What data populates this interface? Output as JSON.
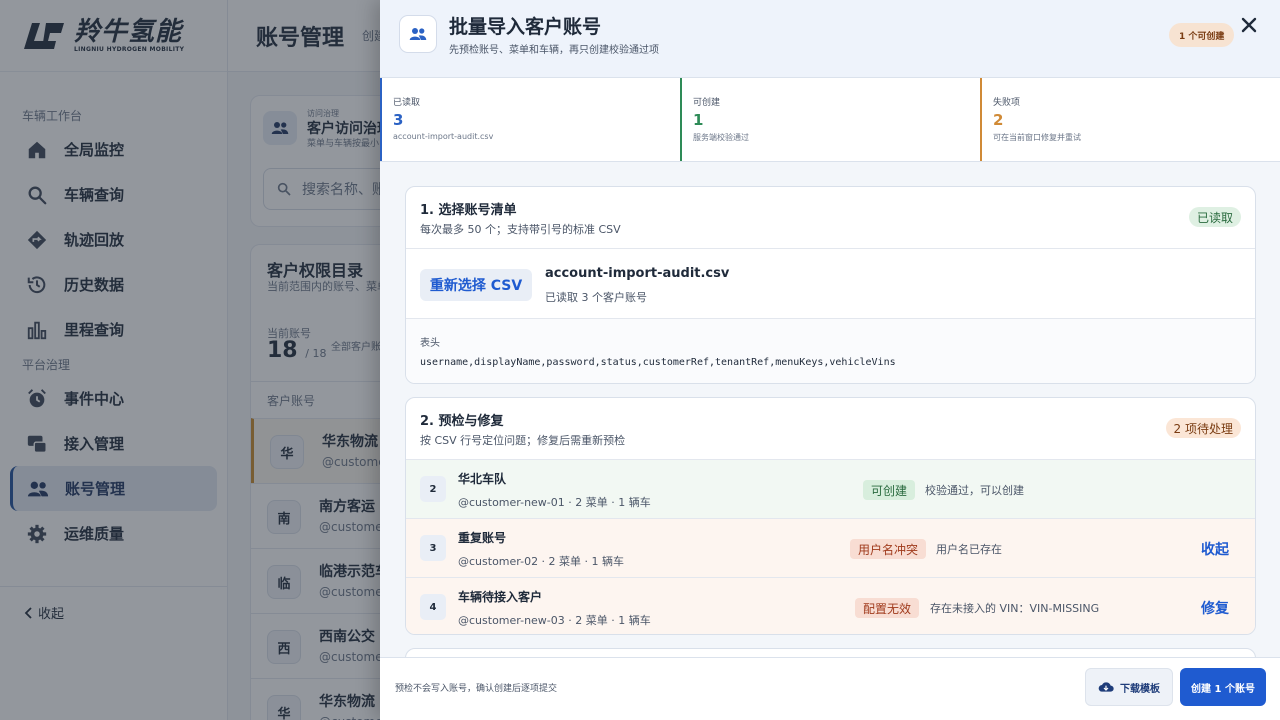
{
  "brand": {
    "name_cn": "羚牛氢能",
    "name_en": "LINGNIU HYDROGEN MOBILITY"
  },
  "sidebar": {
    "section1": "车辆工作台",
    "section2": "平台治理",
    "items": [
      {
        "label": "全局监控",
        "icon": "home-icon"
      },
      {
        "label": "车辆查询",
        "icon": "search-icon"
      },
      {
        "label": "轨迹回放",
        "icon": "route-icon"
      },
      {
        "label": "历史数据",
        "icon": "history-icon"
      },
      {
        "label": "里程查询",
        "icon": "bar-chart-icon"
      },
      {
        "label": "事件中心",
        "icon": "alarm-icon"
      },
      {
        "label": "接入管理",
        "icon": "device-icon"
      },
      {
        "label": "账号管理",
        "icon": "users-icon"
      },
      {
        "label": "运维质量",
        "icon": "gear-icon"
      }
    ],
    "collapse_label": "收起"
  },
  "main": {
    "title": "账号管理",
    "subtitle": "创建",
    "access_tag": "访问治理",
    "access_title": "客户访问治理",
    "access_sub": "菜单与车辆按最小",
    "search_placeholder": "搜索名称、账号",
    "dir_title": "客户权限目录",
    "dir_sub": "当前范围内的账号、菜单",
    "current_label": "当前账号",
    "current_count": "18",
    "current_total": "/ 18",
    "current_note": "全部客户账",
    "list_header": "客户账号",
    "customers": [
      {
        "avatar": "华",
        "name": "华东物流",
        "id": "@customer"
      },
      {
        "avatar": "南",
        "name": "南方客运",
        "id": "@customer"
      },
      {
        "avatar": "临",
        "name": "临港示范车",
        "id": "@customer"
      },
      {
        "avatar": "西",
        "name": "西南公交",
        "id": "@customer"
      },
      {
        "avatar": "华",
        "name": "华东物流",
        "id": "@customer"
      }
    ]
  },
  "drawer": {
    "title": "批量导入客户账号",
    "subtitle": "先预检账号、菜单和车辆，再只创建校验通过项",
    "badge": "1 个可创建",
    "stats": [
      {
        "label": "已读取",
        "value": "3",
        "note": "account-import-audit.csv",
        "color": "#2b62c4"
      },
      {
        "label": "可创建",
        "value": "1",
        "note": "服务端校验通过",
        "color": "#2e8b57"
      },
      {
        "label": "失败项",
        "value": "2",
        "note": "可在当前窗口修复并重试",
        "color": "#d08a36"
      }
    ],
    "step1": {
      "title": "1. 选择账号清单",
      "sub": "每次最多 50 个；支持带引号的标准 CSV",
      "status": "已读取",
      "reselect_label": "重新选择 CSV",
      "file_name": "account-import-audit.csv",
      "file_note": "已读取 3 个客户账号",
      "header_label": "表头",
      "header_value": "username,displayName,password,status,customerRef,tenantRef,menuKeys,vehicleVins"
    },
    "step2": {
      "title": "2. 预检与修复",
      "sub": "按 CSV 行号定位问题；修复后需重新预检",
      "status": "2 项待处理",
      "rows": [
        {
          "num": "2",
          "name": "华北车队",
          "meta": "@customer-new-01 · 2 菜单 · 1 辆车",
          "status": "可创建",
          "msg": "校验通过，可以创建",
          "action": ""
        },
        {
          "num": "3",
          "name": "重复账号",
          "meta": "@customer-02 · 2 菜单 · 1 辆车",
          "status": "用户名冲突",
          "msg": "用户名已存在",
          "action": "收起"
        },
        {
          "num": "4",
          "name": "车辆待接入客户",
          "meta": "@customer-new-03 · 2 菜单 · 1 辆车",
          "status": "配置无效",
          "msg": "存在未接入的 VIN：VIN-MISSING",
          "action": "修复"
        }
      ]
    },
    "footer": {
      "note": "预检不会写入账号，确认创建后逐项提交",
      "download_label": "下载模板",
      "create_label": "创建 1 个账号"
    }
  }
}
